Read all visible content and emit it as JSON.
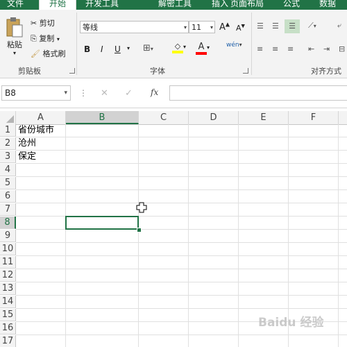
{
  "tabs": [
    "文件",
    "开始",
    "开发工具",
    "解密工具",
    "插入",
    "页面布局",
    "公式",
    "数据"
  ],
  "ribbon": {
    "clipboard": {
      "paste": "粘贴",
      "cut": "剪切",
      "copy": "复制",
      "format_painter": "格式刷",
      "group_label": "剪贴板"
    },
    "font": {
      "name": "等线",
      "size": "11",
      "bold": "B",
      "italic": "I",
      "underline": "U",
      "phonetic": "wén",
      "group_label": "字体"
    },
    "alignment": {
      "group_label": "对齐方式"
    }
  },
  "formula_bar": {
    "name_box": "B8",
    "fx": "fx",
    "cancel": "✕",
    "enter": "✓"
  },
  "sheet": {
    "columns": [
      "A",
      "B",
      "C",
      "D",
      "E",
      "F"
    ],
    "selected_column": "B",
    "rows": [
      "1",
      "2",
      "3",
      "4",
      "5",
      "6",
      "7",
      "8",
      "9",
      "10",
      "11",
      "12",
      "13",
      "14",
      "15",
      "16",
      "17"
    ],
    "selected_row": "8",
    "cells": {
      "A1": "省份城市",
      "A2": "沧州",
      "A3": "保定"
    },
    "selected_cell": "B8"
  },
  "watermark": "Baidu 经验",
  "colors": {
    "accent": "#217346"
  }
}
